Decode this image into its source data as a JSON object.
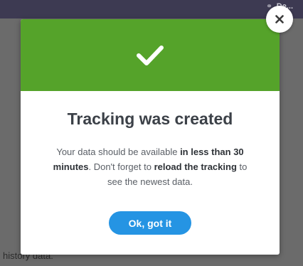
{
  "topbar": {
    "user_label": "De..."
  },
  "background": {
    "partial_text": "history data."
  },
  "modal": {
    "title": "Tracking was created",
    "message": {
      "part1": "Your data should be available ",
      "bold1": "in less than 30 minutes",
      "part2": ". Don't forget to ",
      "bold2": "reload the tracking",
      "part3": " to see the newest data."
    },
    "ok_label": "Ok, got it"
  },
  "colors": {
    "header_green": "#55a32a",
    "button_blue": "#2594e3",
    "topbar": "#3d3a52"
  },
  "icons": {
    "header": "check-icon",
    "close": "close-icon",
    "topbar": "link-icon"
  }
}
